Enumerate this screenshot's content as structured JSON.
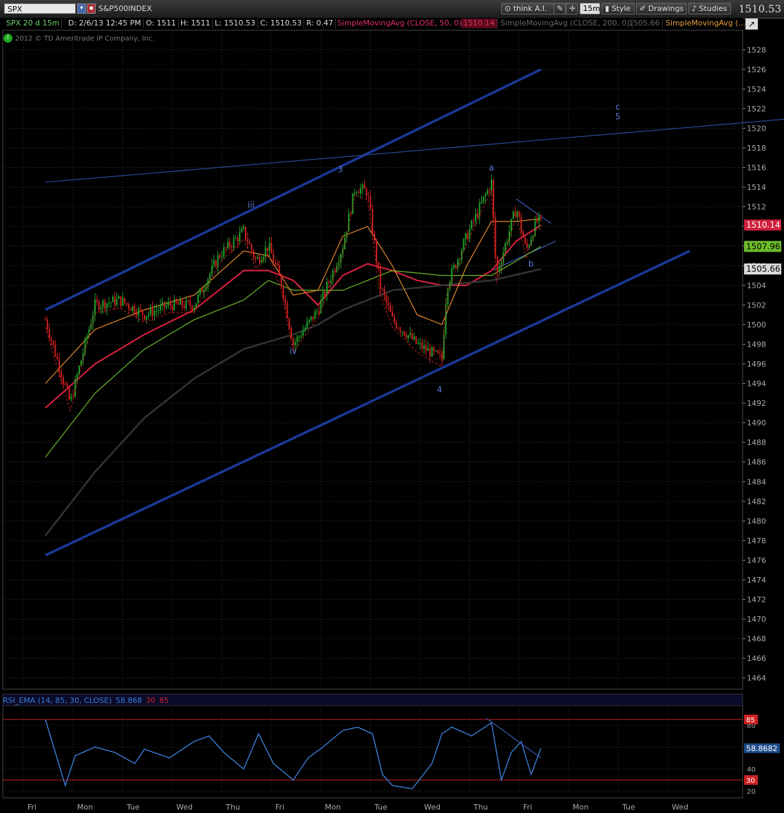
{
  "toolbar": {
    "symbol": "SPX",
    "symbol_name": "S&P500INDEX",
    "think_ai_label": "think A.I.",
    "interval_label": "15m",
    "style_label": "Style",
    "drawings_label": "Drawings",
    "studies_label": "Studies",
    "last_price": "1510.53"
  },
  "info_bar": {
    "symbol_period": "SPX 20 d 15m",
    "date": "D: 2/6/13 12:45 PM",
    "open": "O: 1511",
    "high": "H: 1511",
    "low": "L: 1510.53",
    "close": "C: 1510.53",
    "range": "R: 0.47",
    "sma50_label": "SimpleMovingAvg (CLOSE, 50, 0)",
    "sma50_value": "1510.14",
    "sma200_label": "SimpleMovingAvg (CLOSE, 200, 0)",
    "sma200_value": "1505.66",
    "sma_other_label": "SimpleMovingAvg (..."
  },
  "copyright": "2012 © TD Ameritrade IP Company, Inc.",
  "rsi": {
    "label": "RSI_EMA (14, 85, 30, CLOSE)",
    "value": "58.868",
    "value_axis": "58.8682",
    "oversold": "30",
    "overbought": "85"
  },
  "colors": {
    "background": "#000000",
    "grid": "#3a3a3a",
    "channel": "#1a3a9a",
    "sma50": "#d0203c",
    "sma200": "#2a2a2a",
    "sma_green": "#6dbb2a",
    "sma_orange": "#e88b2a",
    "rsi_line": "#3a7fd6",
    "rsi_bounds": "#cc2222",
    "candle_up": "#1fa32a",
    "candle_down": "#d02020"
  },
  "chart_data": [
    {
      "type": "line",
      "title": "SPX 20 d 15m",
      "x_ticks": [
        "Fri",
        "Mon",
        "Tue",
        "Wed",
        "Thu",
        "Fri",
        "Mon",
        "Tue",
        "Wed",
        "Thu",
        "Fri",
        "Mon",
        "Tue",
        "Wed"
      ],
      "ylim": [
        1463,
        1529
      ],
      "y_ticks": [
        1464,
        1466,
        1468,
        1470,
        1472,
        1474,
        1476,
        1478,
        1480,
        1482,
        1484,
        1486,
        1488,
        1490,
        1492,
        1494,
        1496,
        1498,
        1500,
        1502,
        1504,
        1506,
        1508,
        1510,
        1512,
        1514,
        1516,
        1518,
        1520,
        1522,
        1524,
        1526,
        1528
      ],
      "price_labels": [
        {
          "label": "1510.14",
          "value": 1510.14,
          "color": "#d0203c"
        },
        {
          "label": "1507.96",
          "value": 1507.96,
          "color": "#6dbb2a"
        },
        {
          "label": "1505.66",
          "value": 1505.66,
          "color": "#2a2a2a"
        }
      ],
      "wave_labels": [
        {
          "text": "iii",
          "x": 4.15,
          "y": 1511.9
        },
        {
          "text": "iv",
          "x": 5.0,
          "y": 1497.0
        },
        {
          "text": "3",
          "x": 5.95,
          "y": 1515.5
        },
        {
          "text": "4",
          "x": 7.95,
          "y": 1493.1
        },
        {
          "text": "a",
          "x": 9.0,
          "y": 1515.7
        },
        {
          "text": "b",
          "x": 9.8,
          "y": 1505.9
        },
        {
          "text": "c",
          "x": 11.55,
          "y": 1521.9
        },
        {
          "text": "5",
          "x": 11.55,
          "y": 1520.9
        }
      ],
      "series": [
        {
          "values": [
            [
              0.0,
              1500.5
            ],
            [
              0.5,
              1492.0
            ],
            [
              1.0,
              1502.0
            ],
            [
              1.5,
              1502.5
            ],
            [
              2.0,
              1501.0
            ],
            [
              2.5,
              1502.0
            ],
            [
              3.0,
              1502.0
            ],
            [
              3.5,
              1507.0
            ],
            [
              4.0,
              1509.5
            ],
            [
              4.25,
              1506.5
            ],
            [
              4.5,
              1508.0
            ],
            [
              4.75,
              1504.5
            ],
            [
              5.0,
              1498.0
            ],
            [
              5.5,
              1501.5
            ],
            [
              6.0,
              1508.0
            ],
            [
              6.25,
              1514.0
            ],
            [
              6.5,
              1513.5
            ],
            [
              6.75,
              1504.0
            ],
            [
              7.0,
              1500.5
            ],
            [
              7.5,
              1498.0
            ],
            [
              8.0,
              1496.5
            ],
            [
              8.1,
              1504.0
            ],
            [
              8.5,
              1509.0
            ],
            [
              9.0,
              1514.5
            ],
            [
              9.1,
              1505.0
            ],
            [
              9.5,
              1512.0
            ],
            [
              9.7,
              1507.5
            ],
            [
              9.9,
              1510.5
            ],
            [
              10.0,
              1510.53
            ]
          ]
        },
        {
          "values": [
            [
              0.0,
              1491.5
            ],
            [
              1.0,
              1496.0
            ],
            [
              2.0,
              1499.0
            ],
            [
              3.0,
              1501.5
            ],
            [
              4.0,
              1505.5
            ],
            [
              4.5,
              1505.5
            ],
            [
              5.0,
              1504.5
            ],
            [
              5.5,
              1502.0
            ],
            [
              6.0,
              1505.0
            ],
            [
              6.5,
              1506.2
            ],
            [
              7.0,
              1505.5
            ],
            [
              7.5,
              1504.5
            ],
            [
              8.0,
              1504.0
            ],
            [
              8.5,
              1504.0
            ],
            [
              9.0,
              1505.5
            ],
            [
              9.5,
              1508.5
            ],
            [
              10.0,
              1510.14
            ]
          ]
        },
        {
          "values": [
            [
              0.0,
              1478.5
            ],
            [
              1.0,
              1485.0
            ],
            [
              2.0,
              1490.5
            ],
            [
              3.0,
              1494.5
            ],
            [
              4.0,
              1497.5
            ],
            [
              5.0,
              1499.0
            ],
            [
              5.5,
              1500.0
            ],
            [
              6.0,
              1501.5
            ],
            [
              7.0,
              1503.5
            ],
            [
              8.0,
              1504.0
            ],
            [
              9.0,
              1504.5
            ],
            [
              10.0,
              1505.66
            ]
          ]
        },
        {
          "values": [
            [
              0.0,
              1486.5
            ],
            [
              1.0,
              1493.0
            ],
            [
              2.0,
              1497.5
            ],
            [
              3.0,
              1500.5
            ],
            [
              4.0,
              1502.5
            ],
            [
              4.5,
              1504.5
            ],
            [
              5.0,
              1503.5
            ],
            [
              6.0,
              1503.5
            ],
            [
              7.0,
              1505.5
            ],
            [
              8.0,
              1505.0
            ],
            [
              9.0,
              1505.0
            ],
            [
              10.0,
              1507.96
            ]
          ]
        },
        {
          "values": [
            [
              0.0,
              1494.0
            ],
            [
              1.0,
              1499.5
            ],
            [
              2.0,
              1501.5
            ],
            [
              3.0,
              1503.0
            ],
            [
              4.0,
              1507.5
            ],
            [
              4.5,
              1507.0
            ],
            [
              5.0,
              1503.0
            ],
            [
              5.5,
              1503.5
            ],
            [
              6.0,
              1509.0
            ],
            [
              6.5,
              1510.0
            ],
            [
              7.0,
              1506.0
            ],
            [
              7.5,
              1501.0
            ],
            [
              8.0,
              1500.0
            ],
            [
              8.5,
              1506.0
            ],
            [
              9.0,
              1510.5
            ],
            [
              9.5,
              1510.5
            ],
            [
              10.0,
              1510.8
            ]
          ]
        }
      ],
      "trendlines": [
        {
          "from": [
            0.0,
            1501.5
          ],
          "to": [
            10.0,
            1526.0
          ]
        },
        {
          "from": [
            0.0,
            1476.5
          ],
          "to": [
            13.0,
            1507.5
          ]
        },
        {
          "from": [
            0.0,
            1514.5
          ],
          "to": [
            15.1,
            1521.0
          ]
        },
        {
          "from": [
            9.5,
            1512.8
          ],
          "to": [
            10.2,
            1510.3
          ]
        },
        {
          "from": [
            9.0,
            1505.5
          ],
          "to": [
            10.3,
            1508.5
          ]
        }
      ]
    },
    {
      "type": "line",
      "title": "RSI_EMA (14, 85, 30, CLOSE)",
      "ylim": [
        15,
        95
      ],
      "y_ticks": [
        20,
        40,
        60,
        80
      ],
      "bounds": [
        30,
        85
      ],
      "series": [
        {
          "name": "RSI_EMA",
          "values": [
            [
              0.0,
              85
            ],
            [
              0.2,
              55
            ],
            [
              0.4,
              25
            ],
            [
              0.6,
              52
            ],
            [
              1.0,
              60
            ],
            [
              1.4,
              55
            ],
            [
              1.8,
              45
            ],
            [
              2.0,
              58
            ],
            [
              2.5,
              50
            ],
            [
              3.0,
              65
            ],
            [
              3.3,
              70
            ],
            [
              3.6,
              55
            ],
            [
              4.0,
              40
            ],
            [
              4.3,
              72
            ],
            [
              4.6,
              45
            ],
            [
              5.0,
              30
            ],
            [
              5.3,
              50
            ],
            [
              5.6,
              60
            ],
            [
              6.0,
              75
            ],
            [
              6.3,
              78
            ],
            [
              6.6,
              72
            ],
            [
              6.8,
              35
            ],
            [
              7.0,
              25
            ],
            [
              7.4,
              22
            ],
            [
              7.8,
              45
            ],
            [
              8.0,
              72
            ],
            [
              8.2,
              78
            ],
            [
              8.6,
              70
            ],
            [
              9.0,
              82
            ],
            [
              9.2,
              30
            ],
            [
              9.4,
              55
            ],
            [
              9.6,
              65
            ],
            [
              9.8,
              35
            ],
            [
              10.0,
              58.87
            ]
          ]
        }
      ],
      "trendlines": [
        {
          "from": [
            8.9,
            86.0
          ],
          "to": [
            10.0,
            50.0
          ]
        }
      ]
    }
  ]
}
